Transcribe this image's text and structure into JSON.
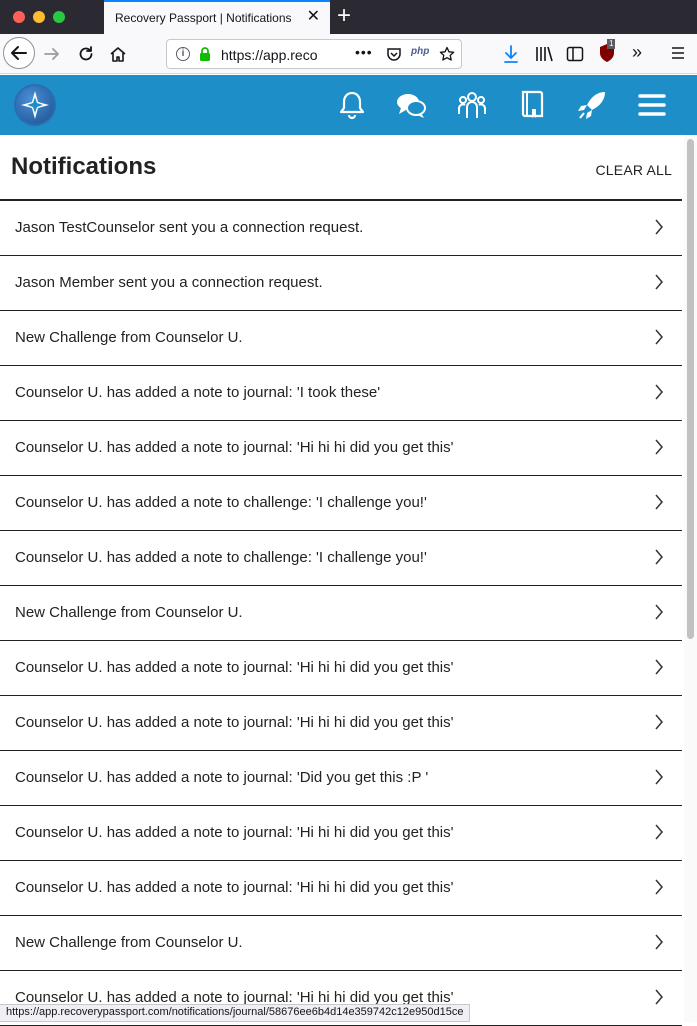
{
  "browser": {
    "tab_title": "Recovery Passport | Notifications",
    "url": "https://app.recoverypassport.com",
    "url_visible": "https://app.reco",
    "status_url": "https://app.recoverypassport.com/notifications/journal/58676ee6b4d14e359742c12e950d15ce",
    "php_label": "php",
    "ublock_badge": "1"
  },
  "colors": {
    "header_bg": "#1e8ec9",
    "text": "#222222"
  },
  "header": {
    "icons": [
      "compass-logo",
      "bell-icon",
      "chat-icon",
      "people-icon",
      "journal-icon",
      "rocket-icon",
      "menu-icon"
    ]
  },
  "page": {
    "title": "Notifications",
    "clear_all": "CLEAR ALL"
  },
  "notifications": [
    "Jason TestCounselor sent you a connection request.",
    "Jason Member sent you a connection request.",
    "New Challenge from Counselor U.",
    "Counselor U. has added a note to journal: 'I took these'",
    "Counselor U. has added a note to journal: 'Hi hi hi did you get this'",
    "Counselor U. has added a note to challenge: 'I challenge you!'",
    "Counselor U. has added a note to challenge: 'I challenge you!'",
    "New Challenge from Counselor U.",
    "Counselor U. has added a note to journal: 'Hi hi hi did you get this'",
    "Counselor U. has added a note to journal: 'Hi hi hi did you get this'",
    "Counselor U. has added a note to journal: 'Did you get this :P '",
    "Counselor U. has added a note to journal: 'Hi hi hi did you get this'",
    "Counselor U. has added a note to journal: 'Hi hi hi did you get this'",
    "New Challenge from Counselor U.",
    "Counselor U. has added a note to journal: 'Hi hi hi did you get this'"
  ]
}
